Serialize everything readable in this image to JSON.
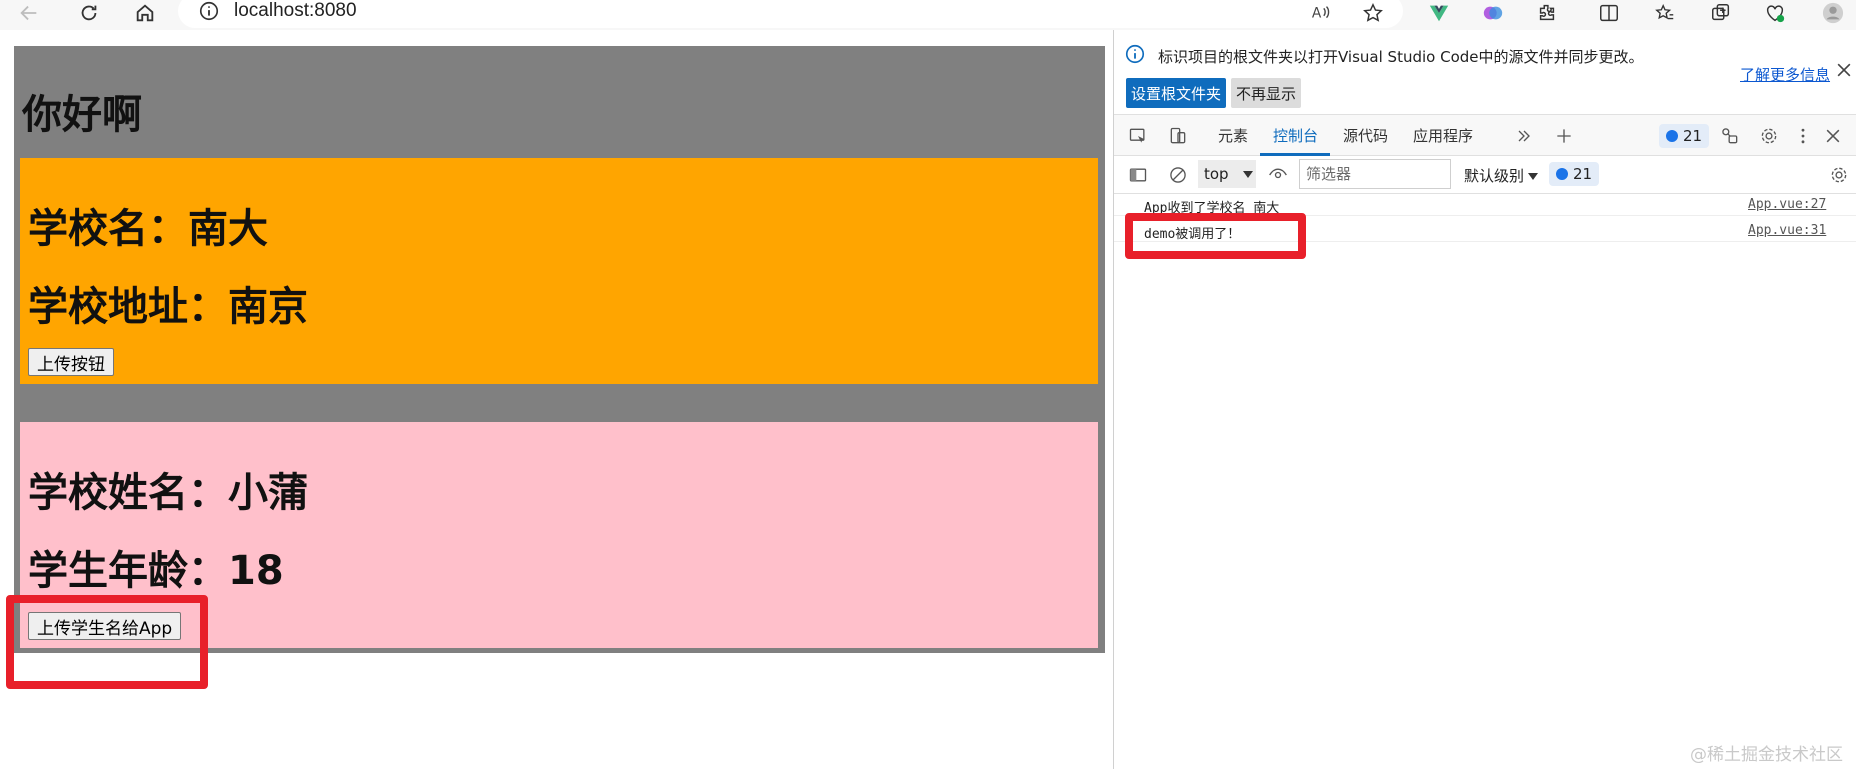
{
  "browser": {
    "url": "localhost:8080",
    "icons": [
      "back-icon",
      "reload-icon",
      "home-icon",
      "info-icon",
      "read-aloud-icon",
      "favorite-star-icon",
      "vue-devtools-icon",
      "copilot-icon",
      "extensions-icon",
      "split-screen-icon",
      "favorites-icon",
      "collections-icon",
      "browser-essentials-icon",
      "profile-avatar-icon"
    ]
  },
  "page": {
    "title": "你好啊",
    "school": {
      "name_line": "学校名：南大",
      "address_line": "学校地址：南京",
      "button_label": "上传按钮",
      "color": "#ffa500"
    },
    "student": {
      "name_line": "学校姓名：小蒲",
      "age_line": "学生年龄：18",
      "button_label": "上传学生名给App",
      "color": "#ffc0cb"
    },
    "root_color": "#808080"
  },
  "devtools": {
    "info_bar": {
      "message": "标识项目的根文件夹以打开Visual Studio Code中的源文件并同步更改。",
      "link": "了解更多信息",
      "primary_button": "设置根文件夹",
      "secondary_button": "不再显示"
    },
    "tabs": [
      "元素",
      "控制台",
      "源代码",
      "应用程序"
    ],
    "active_tab": "控制台",
    "issue_count": "21",
    "console": {
      "context": "top",
      "filter_placeholder": "筛选器",
      "level": "默认级别",
      "message_count": "21",
      "logs": [
        {
          "message": "App收到了学校名 南大",
          "source": "App.vue:27"
        },
        {
          "message": "demo被调用了！",
          "source": "App.vue:31"
        }
      ]
    }
  },
  "watermark": "@稀土掘金技术社区",
  "accent_colors": {
    "highlight": "#e8202a",
    "link": "#0b57d0",
    "primary": "#0f6cbd"
  }
}
